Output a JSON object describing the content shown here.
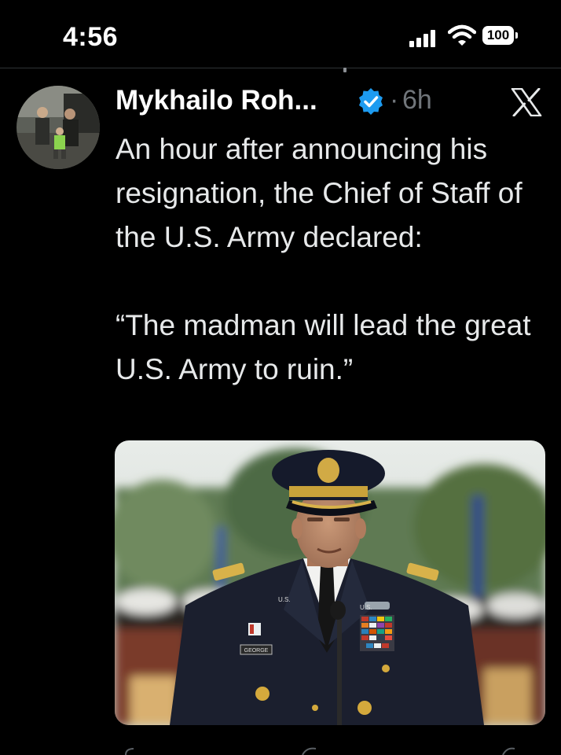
{
  "status_bar": {
    "time": "4:56",
    "battery": "100"
  },
  "tweet": {
    "author_name": "Mykhailo Roh...",
    "separator": "·",
    "time_ago": "6h",
    "text_lines": [
      "An hour after announcing his resignation, the Chief of Staff of the U.S. Army declared:",
      "“The madman will lead the great U.S. Army to ruin.”"
    ]
  },
  "media": {
    "nameplate": "GEORGE",
    "collar_insignia": "U.S."
  },
  "colors": {
    "background": "#000000",
    "text": "#e7e9ea",
    "muted": "#71767b",
    "verified": "#1d9bf0"
  }
}
